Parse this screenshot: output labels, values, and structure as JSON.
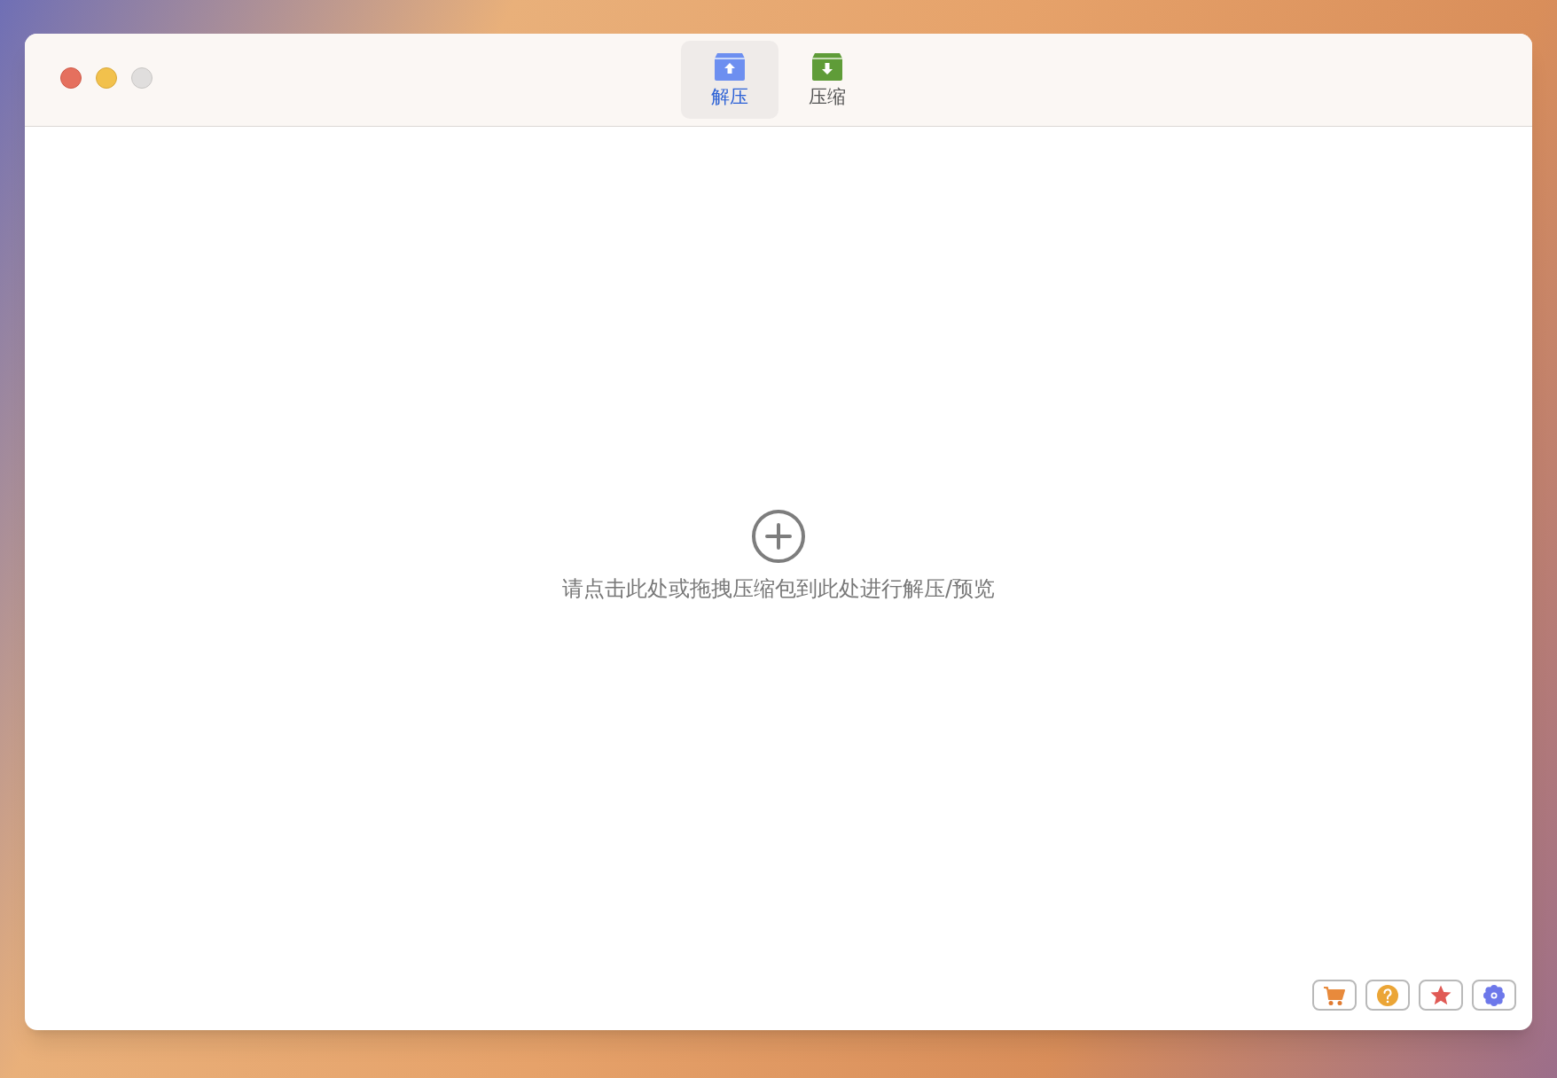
{
  "window": {
    "controls": [
      {
        "kind": "close",
        "disabled": false
      },
      {
        "kind": "minimize",
        "disabled": false
      },
      {
        "kind": "zoom",
        "disabled": true
      }
    ]
  },
  "tabs": [
    {
      "label": "解压",
      "kind": "extract",
      "selected": true
    },
    {
      "label": "压缩",
      "kind": "compress",
      "selected": false
    }
  ],
  "drop_zone": {
    "hint": "请点击此处或拖拽压缩包到此处进行解压/预览"
  },
  "footer_buttons": [
    {
      "kind": "cart"
    },
    {
      "kind": "help"
    },
    {
      "kind": "star"
    },
    {
      "kind": "settings"
    }
  ]
}
